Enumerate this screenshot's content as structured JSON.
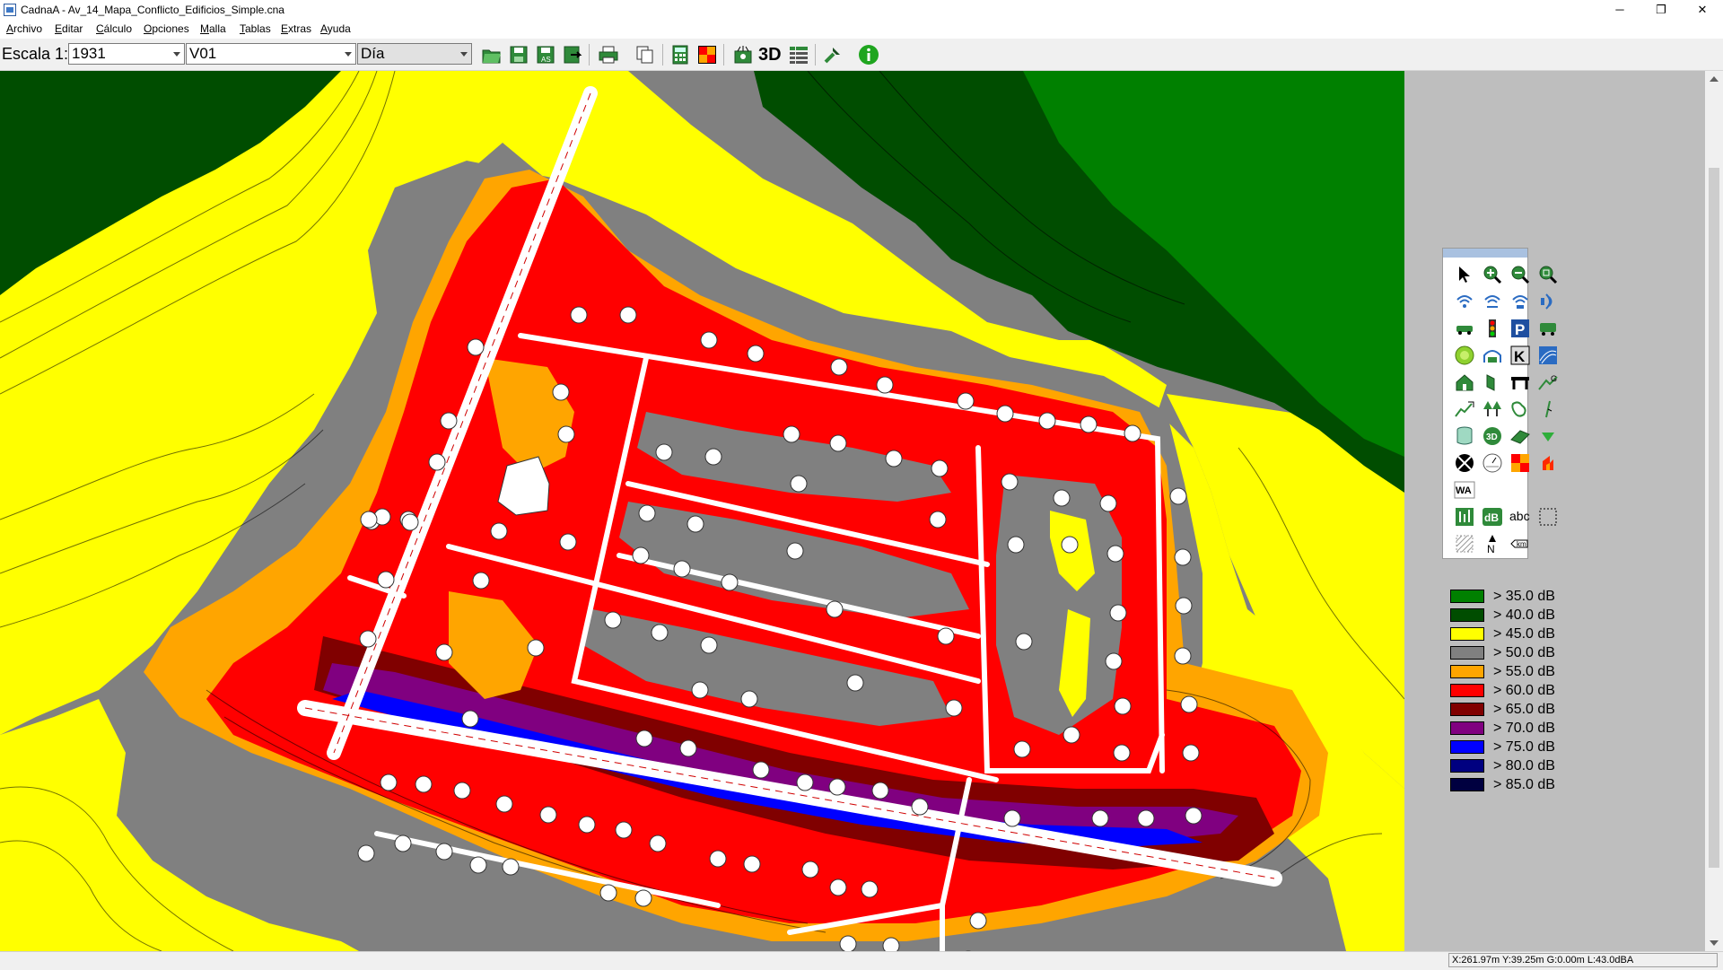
{
  "window": {
    "title": "CadnaA - Av_14_Mapa_Conflicto_Edificios_Simple.cna",
    "controls": {
      "minimize": "─",
      "maximize": "❐",
      "close": "✕"
    }
  },
  "menu": [
    {
      "label": "Archivo",
      "accel": "A",
      "rest": "rchivo"
    },
    {
      "label": "Editar",
      "accel": "E",
      "rest": "ditar"
    },
    {
      "label": "Cálculo",
      "accel": "C",
      "rest": "álculo"
    },
    {
      "label": "Opciones",
      "accel": "O",
      "rest": "pciones"
    },
    {
      "label": "Malla",
      "accel": "M",
      "rest": "alla"
    },
    {
      "label": "Tablas",
      "accel": "T",
      "rest": "ablas"
    },
    {
      "label": "Extras",
      "accel": "E",
      "rest": "xtras"
    },
    {
      "label": "Ayuda",
      "accel": "A",
      "rest": "yuda"
    }
  ],
  "toolbar": {
    "scale_label": "Escala 1:",
    "scale_value": "1931",
    "variant_value": "V01",
    "period_value": "Día",
    "buttons": [
      "open-icon",
      "save-icon",
      "save-as-icon",
      "export-icon",
      "print-icon",
      "copy-icon",
      "calculator-icon",
      "grid-map-icon",
      "view-3d-icon",
      "label-3d",
      "table-icon",
      "tools-icon",
      "info-icon"
    ],
    "label_3d": "3D"
  },
  "palette_tools": [
    "pointer-icon",
    "zoom-in-icon",
    "zoom-out-icon",
    "zoom-window-icon",
    "point-source-icon",
    "line-source-icon",
    "area-source-icon",
    "vertical-source-icon",
    "road-icon",
    "traffic-light-icon",
    "parking-icon",
    "railway-icon",
    "industry-icon",
    "tunnel-icon",
    "k-icon",
    "wave-icon",
    "building-icon",
    "barrier-icon",
    "bridge-icon",
    "terrain-icon",
    "contour-line-icon",
    "forest-icon",
    "ground-absorption-icon",
    "ruler-icon",
    "cylinder-icon",
    "object-3d-icon",
    "embankment-icon",
    "height-point-icon",
    "receiver-cross-icon",
    "dial-icon",
    "grid-icon",
    "fire-icon",
    "wa-icon",
    "calc-area-icon",
    "db-icon",
    "text-icon",
    "section-icon",
    "hatch-icon",
    "north-arrow-icon",
    "km-scale-icon"
  ],
  "palette_labels": {
    "db": "dB",
    "abc": "abc",
    "wa": "WA",
    "km": "km",
    "k": "K",
    "p": "P",
    "north": "N",
    "d3": "3D"
  },
  "legend": [
    {
      "label": ">  35.0 dB",
      "color": "#008000"
    },
    {
      "label": ">  40.0 dB",
      "color": "#004d00"
    },
    {
      "label": ">  45.0 dB",
      "color": "#ffff00"
    },
    {
      "label": ">  50.0 dB",
      "color": "#808080"
    },
    {
      "label": ">  55.0 dB",
      "color": "#ffa500"
    },
    {
      "label": ">  60.0 dB",
      "color": "#ff0000"
    },
    {
      "label": ">  65.0 dB",
      "color": "#800000"
    },
    {
      "label": ">  70.0 dB",
      "color": "#800080"
    },
    {
      "label": ">  75.0 dB",
      "color": "#0000ff"
    },
    {
      "label": ">  80.0 dB",
      "color": "#000080"
    },
    {
      "label": ">  85.0 dB",
      "color": "#000040"
    }
  ],
  "status": {
    "coords": "X:261.97m Y:39.25m G:0.00m L:43.0dBA"
  }
}
